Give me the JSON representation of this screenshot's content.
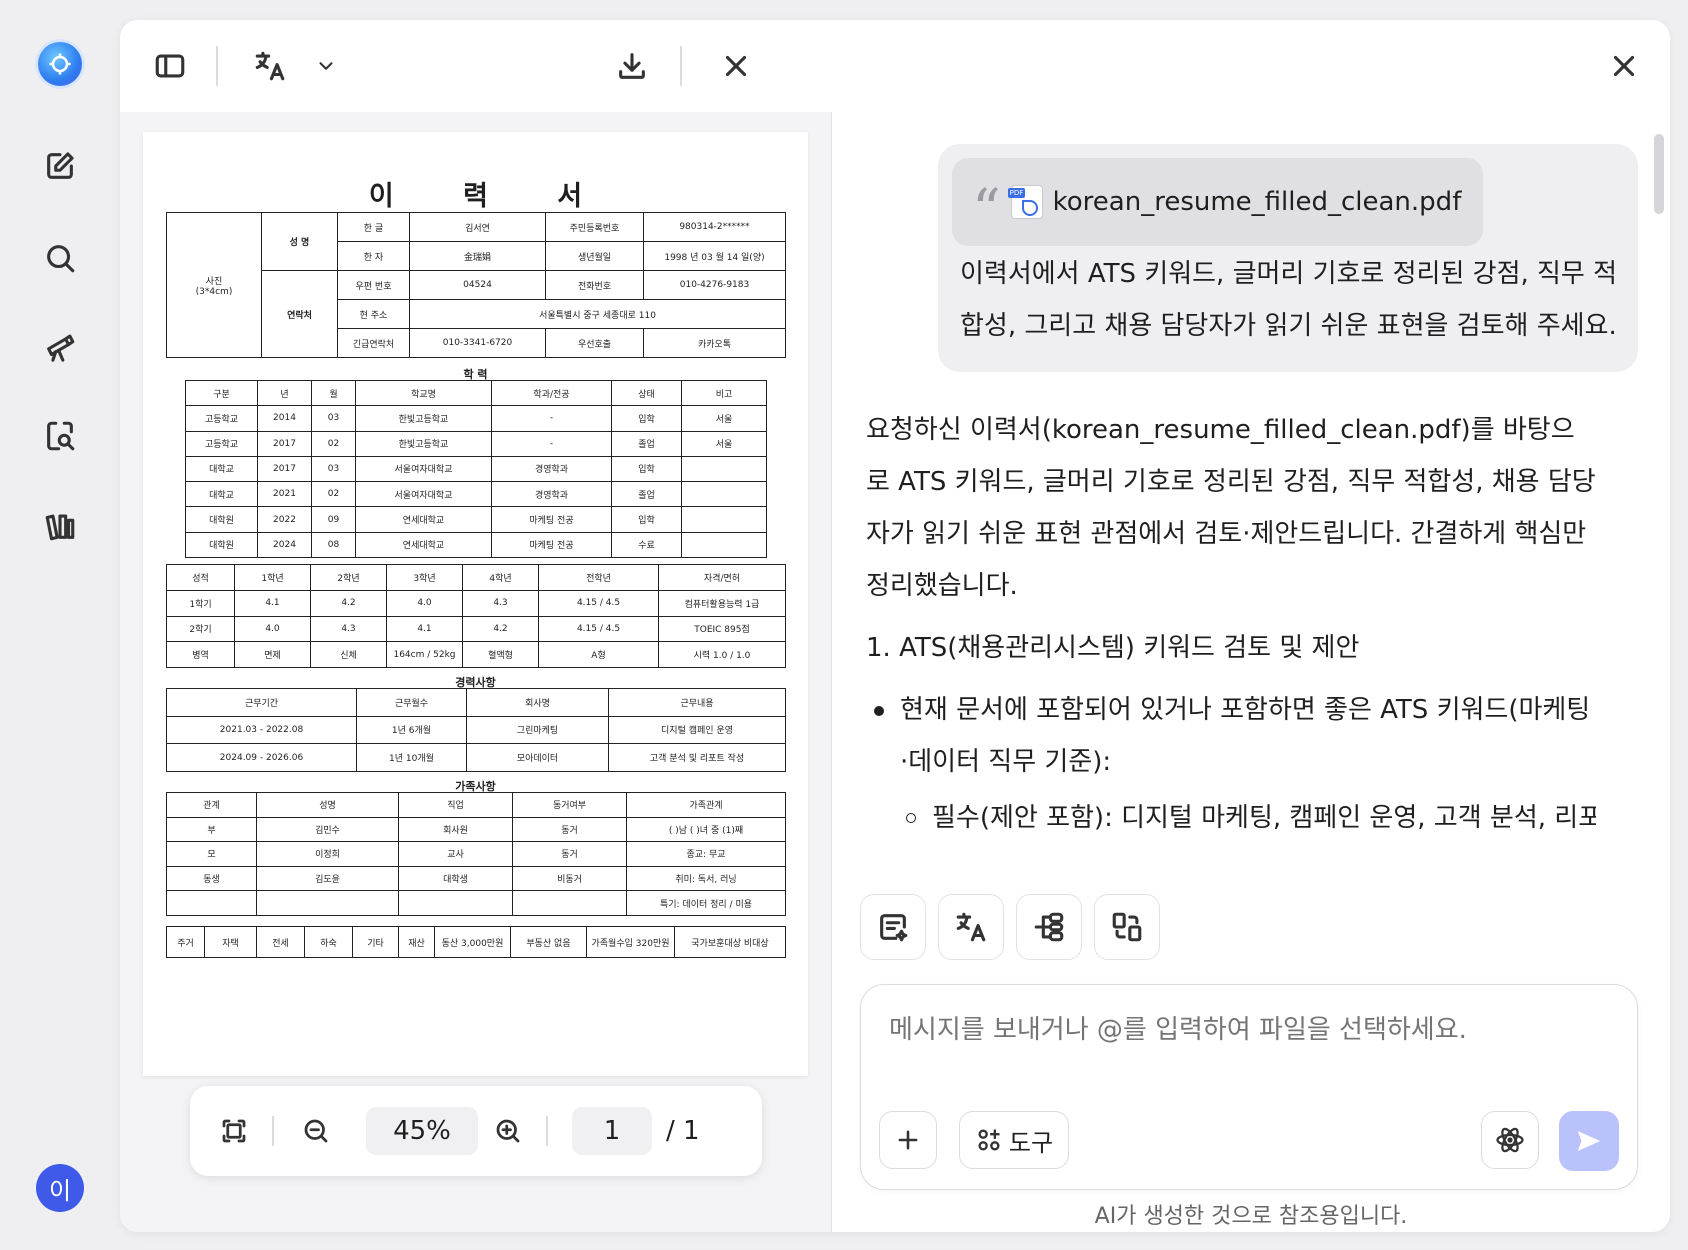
{
  "sidebar": {
    "items": [
      {
        "icon": "new-chat-icon"
      },
      {
        "icon": "search-icon"
      },
      {
        "icon": "presentation-icon"
      },
      {
        "icon": "document-search-icon"
      },
      {
        "icon": "library-icon"
      }
    ],
    "avatar_label": "이"
  },
  "viewer": {
    "zoom": "45%",
    "page_current": "1",
    "page_total": "/ 1",
    "document": {
      "title": "이 력 서",
      "personal": {
        "photo_label_1": "사진",
        "photo_label_2": "(3*4cm)",
        "name_label": "성 명",
        "contact_label": "연락처",
        "hangul_label": "한 글",
        "hangul_value": "김서연",
        "hanja_label": "한 자",
        "hanja_value": "金瑞娟",
        "rrn_label": "주민등록번호",
        "rrn_value": "980314-2******",
        "birth_label": "생년월일",
        "birth_value": "1998 년 03 월 14 일(양)",
        "postal_label": "우편 번호",
        "postal_value": "04524",
        "phone_label": "전화번호",
        "phone_value": "010-4276-9183",
        "address_label": "현 주소",
        "address_value": "서울특별시 중구 세종대로 110",
        "emergency_label": "긴급연락처",
        "emergency_value": "010-3341-6720",
        "priority_label": "우선호출",
        "priority_value": "카카오톡"
      },
      "education_title": "학 력",
      "education_headers": [
        "구분",
        "년",
        "월",
        "학교명",
        "학과/전공",
        "상태",
        "비고"
      ],
      "education_rows": [
        [
          "고등학교",
          "2014",
          "03",
          "한빛고등학교",
          "-",
          "입학",
          "서울"
        ],
        [
          "고등학교",
          "2017",
          "02",
          "한빛고등학교",
          "-",
          "졸업",
          "서울"
        ],
        [
          "대학교",
          "2017",
          "03",
          "서울여자대학교",
          "경영학과",
          "입학",
          ""
        ],
        [
          "대학교",
          "2021",
          "02",
          "서울여자대학교",
          "경영학과",
          "졸업",
          ""
        ],
        [
          "대학원",
          "2022",
          "09",
          "연세대학교",
          "마케팅 전공",
          "입학",
          ""
        ],
        [
          "대학원",
          "2024",
          "08",
          "연세대학교",
          "마케팅 전공",
          "수료",
          ""
        ]
      ],
      "grades_headers": [
        "성적",
        "1학년",
        "2학년",
        "3학년",
        "4학년",
        "전학년",
        "자격/면허"
      ],
      "grades_rows": [
        [
          "1학기",
          "4.1",
          "4.2",
          "4.0",
          "4.3",
          "4.15 / 4.5",
          "컴퓨터활용능력 1급"
        ],
        [
          "2학기",
          "4.0",
          "4.3",
          "4.1",
          "4.2",
          "4.15 / 4.5",
          "TOEIC 895점"
        ],
        [
          "병역",
          "면제",
          "신체",
          "164cm / 52kg",
          "혈액형",
          "A형",
          "시력 1.0 / 1.0"
        ]
      ],
      "career_title": "경력사항",
      "career_headers": [
        "근무기간",
        "근무월수",
        "회사명",
        "근무내용"
      ],
      "career_rows": [
        [
          "2021.03 - 2022.08",
          "1년 6개월",
          "그린마케팅",
          "디지털 캠페인 운영"
        ],
        [
          "2024.09 - 2026.06",
          "1년 10개월",
          "모아데이터",
          "고객 분석 및 리포트 작성"
        ]
      ],
      "family_title": "가족사항",
      "family_headers": [
        "관계",
        "성명",
        "직업",
        "동거여부",
        "가족관계"
      ],
      "family_rows": [
        [
          "부",
          "김민수",
          "회사원",
          "동거",
          "( )남 ( )녀 중 (1)째"
        ],
        [
          "모",
          "이정희",
          "교사",
          "동거",
          "종교: 무교"
        ],
        [
          "동생",
          "김도윤",
          "대학생",
          "비동거",
          "취미: 독서, 러닝"
        ],
        [
          "",
          "",
          "",
          "",
          "특기: 데이터 정리 / 미용"
        ]
      ],
      "housing_row": [
        "주거",
        "자택",
        "전세",
        "하숙",
        "기타",
        "재산",
        "동산 3,000만원",
        "부동산 없음",
        "가족월수입 320만원",
        "국가보훈대상 비대상"
      ]
    }
  },
  "chat": {
    "user_message": {
      "attachment_name": "korean_resume_filled_clean.pdf",
      "text": "이력서에서 ATS 키워드, 글머리 기호로 정리된 강점, 직무 적합성, 그리고 채용 담당자가 읽기 쉬운 표현을 검토해 주세요."
    },
    "answer": {
      "intro": "요청하신 이력서(korean_resume_filled_clean.pdf)를 바탕으로 ATS 키워드, 글머리 기호로 정리된 강점, 직무 적합성, 채용 담당자가 읽기 쉬운 표현 관점에서 검토·제안드립니다. 간결하게 핵심만 정리했습니다.",
      "section1": "1. ATS(채용관리시스템) 키워드 검토 및 제안",
      "bullet1": "현재 문서에 포함되어 있거나 포함하면 좋은 ATS 키워드(마케팅·데이터 직무 기준):",
      "sub1": "필수(제안 포함): 디지털 마케팅, 캠페인 운영, 고객 분석, 리포트"
    },
    "quick_actions": [
      "summarize-icon",
      "translate-icon",
      "mindmap-icon",
      "convert-icon"
    ],
    "compose": {
      "placeholder": "메시지를 보내거나 @를 입력하여 파일을 선택하세요.",
      "tools_label": "도구"
    },
    "disclaimer": "AI가 생성한 것으로 참조용입니다."
  }
}
